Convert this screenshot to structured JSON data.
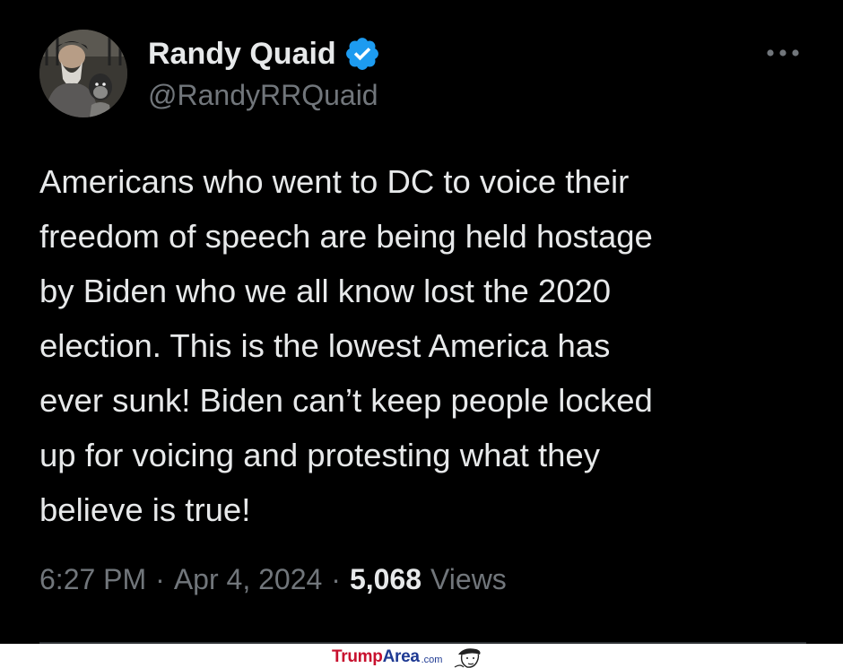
{
  "tweet": {
    "author": {
      "name": "Randy Quaid",
      "handle": "@RandyRRQuaid",
      "verified": true,
      "avatar_icon": "user-avatar"
    },
    "text": "Americans who went to DC to voice their\nfreedom of speech are being held hostage\nby Biden who we all know lost the 2020\nelection. This is the lowest America has\never sunk! Biden can’t keep people locked\nup for voicing and protesting what they\nbelieve is true!",
    "meta": {
      "time": "6:27 PM",
      "separator": "·",
      "date": "Apr 4, 2024",
      "views_count": "5,068",
      "views_label": "Views"
    },
    "more_icon": "more-horizontal-icon"
  },
  "watermark": {
    "part1": "Trump",
    "part2": "Area",
    "part3": ".com"
  },
  "colors": {
    "background": "#000000",
    "primary_text": "#e7e9ea",
    "secondary_text": "#71767b",
    "verified_blue": "#1d9bf0",
    "watermark_red": "#c8102e",
    "watermark_blue": "#1f3a93"
  }
}
